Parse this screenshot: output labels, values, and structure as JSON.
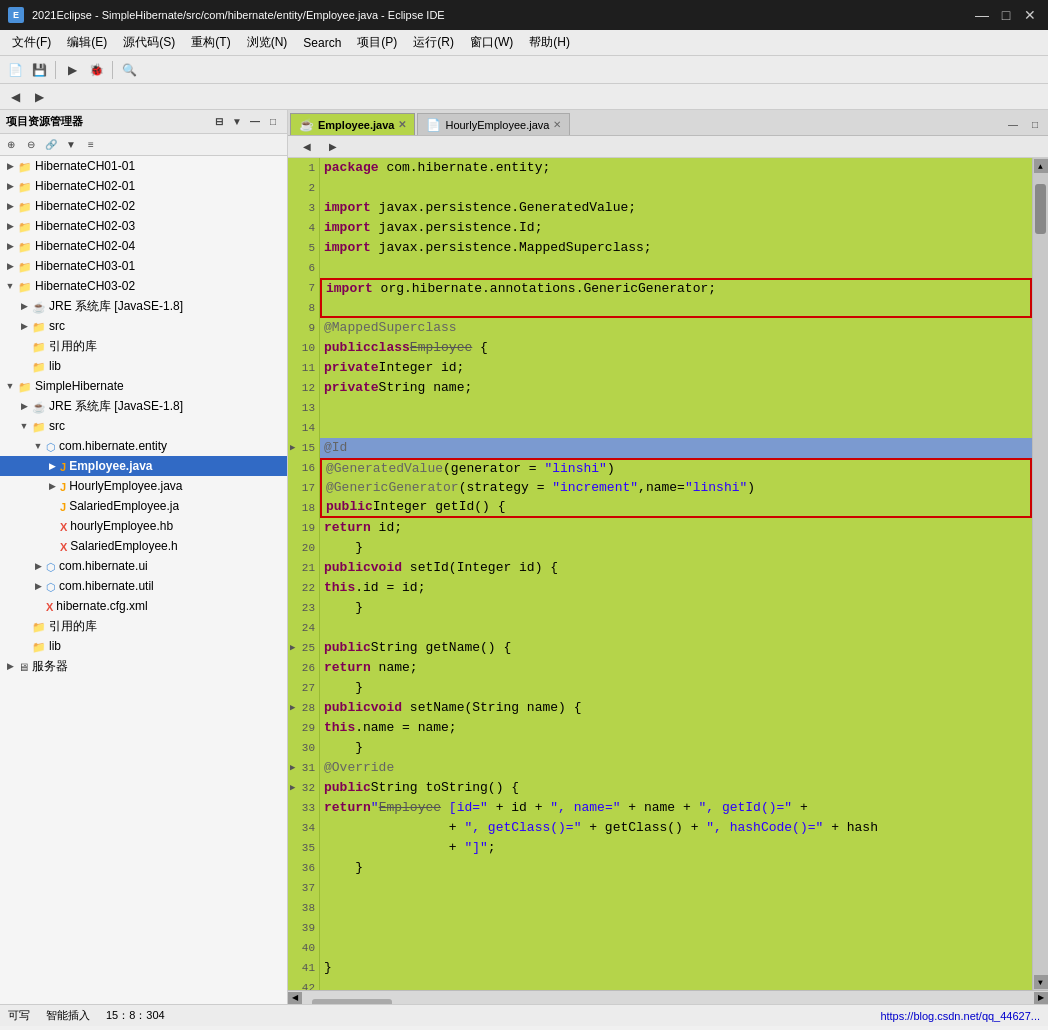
{
  "titlebar": {
    "title": "2021Eclipse - SimpleHibernate/src/com/hibernate/entity/Employee.java - Eclipse IDE",
    "icon": "E",
    "btn_min": "—",
    "btn_max": "□",
    "btn_close": "✕"
  },
  "menubar": {
    "items": [
      "文件(F)",
      "编辑(E)",
      "源代码(S)",
      "重构(T)",
      "浏览(N)",
      "Search",
      "项目(P)",
      "运行(R)",
      "窗口(W)",
      "帮助(H)"
    ]
  },
  "tabs": {
    "active": "Employee.java",
    "items": [
      "Employee.java",
      "HourlyEmployee.java"
    ]
  },
  "sidebar": {
    "title": "项目资源管理器",
    "tree": [
      {
        "indent": 0,
        "arrow": "▶",
        "icon": "📁",
        "label": "HibernateCH01-01",
        "type": "folder"
      },
      {
        "indent": 0,
        "arrow": "▶",
        "icon": "📁",
        "label": "HibernateCH02-01",
        "type": "folder"
      },
      {
        "indent": 0,
        "arrow": "▶",
        "icon": "📁",
        "label": "HibernateCH02-02",
        "type": "folder"
      },
      {
        "indent": 0,
        "arrow": "▶",
        "icon": "📁",
        "label": "HibernateCH02-03",
        "type": "folder"
      },
      {
        "indent": 0,
        "arrow": "▶",
        "icon": "📁",
        "label": "HibernateCH02-04",
        "type": "folder"
      },
      {
        "indent": 0,
        "arrow": "▶",
        "icon": "📁",
        "label": "HibernateCH03-01",
        "type": "folder"
      },
      {
        "indent": 0,
        "arrow": "▼",
        "icon": "📁",
        "label": "HibernateCH03-02",
        "type": "folder",
        "expanded": true
      },
      {
        "indent": 1,
        "arrow": "▶",
        "icon": "☕",
        "label": "JRE 系统库 [JavaSE-1.8]",
        "type": "lib"
      },
      {
        "indent": 1,
        "arrow": "▶",
        "icon": "📁",
        "label": "src",
        "type": "folder"
      },
      {
        "indent": 1,
        "arrow": " ",
        "icon": "📁",
        "label": "引用的库",
        "type": "folder"
      },
      {
        "indent": 1,
        "arrow": " ",
        "icon": "📁",
        "label": "lib",
        "type": "folder"
      },
      {
        "indent": 0,
        "arrow": "▼",
        "icon": "📁",
        "label": "SimpleHibernate",
        "type": "folder",
        "expanded": true
      },
      {
        "indent": 1,
        "arrow": "▶",
        "icon": "☕",
        "label": "JRE 系统库 [JavaSE-1.8]",
        "type": "lib"
      },
      {
        "indent": 1,
        "arrow": "▼",
        "icon": "📁",
        "label": "src",
        "type": "folder",
        "expanded": true
      },
      {
        "indent": 2,
        "arrow": "▼",
        "icon": "📦",
        "label": "com.hibernate.entity",
        "type": "package",
        "expanded": true
      },
      {
        "indent": 3,
        "arrow": "▶",
        "icon": "☕",
        "label": "Employee.java",
        "type": "java",
        "selected": true
      },
      {
        "indent": 3,
        "arrow": "▶",
        "icon": "☕",
        "label": "HourlyEmployee.java",
        "type": "java"
      },
      {
        "indent": 3,
        "arrow": " ",
        "icon": "📄",
        "label": "SalariedEmployee.ja",
        "type": "java"
      },
      {
        "indent": 3,
        "arrow": " ",
        "icon": "📄",
        "label": "hourlyEmployee.hb",
        "type": "xml"
      },
      {
        "indent": 3,
        "arrow": " ",
        "icon": "📄",
        "label": "SalariedEmployee.h",
        "type": "xml"
      },
      {
        "indent": 2,
        "arrow": "▶",
        "icon": "📦",
        "label": "com.hibernate.ui",
        "type": "package"
      },
      {
        "indent": 2,
        "arrow": "▶",
        "icon": "📦",
        "label": "com.hibernate.util",
        "type": "package"
      },
      {
        "indent": 2,
        "arrow": " ",
        "icon": "📄",
        "label": "hibernate.cfg.xml",
        "type": "xml"
      },
      {
        "indent": 1,
        "arrow": " ",
        "icon": "📁",
        "label": "引用的库",
        "type": "folder"
      },
      {
        "indent": 1,
        "arrow": " ",
        "icon": "📁",
        "label": "lib",
        "type": "folder"
      },
      {
        "indent": 0,
        "arrow": "▶",
        "icon": "🖥️",
        "label": "服务器",
        "type": "server"
      }
    ]
  },
  "code": {
    "lines": [
      {
        "num": 1,
        "content": "package com.hibernate.entity;",
        "style": "normal"
      },
      {
        "num": 2,
        "content": "",
        "style": "normal"
      },
      {
        "num": 3,
        "content": "import javax.persistence.GeneratedValue;",
        "style": "normal"
      },
      {
        "num": 4,
        "content": "import javax.persistence.Id;",
        "style": "normal"
      },
      {
        "num": 5,
        "content": "import javax.persistence.MappedSuperclass;",
        "style": "normal"
      },
      {
        "num": 6,
        "content": "",
        "style": "normal"
      },
      {
        "num": 7,
        "content": "import org.hibernate.annotations.GenericGenerator;",
        "style": "boxed-top"
      },
      {
        "num": 8,
        "content": "",
        "style": "boxed-bot"
      },
      {
        "num": 9,
        "content": "@MappedSuperclass",
        "style": "normal"
      },
      {
        "num": 10,
        "content": "public class Employee {",
        "style": "normal"
      },
      {
        "num": 11,
        "content": "    private Integer id;",
        "style": "normal"
      },
      {
        "num": 12,
        "content": "    private String name;",
        "style": "normal"
      },
      {
        "num": 13,
        "content": "",
        "style": "normal"
      },
      {
        "num": 14,
        "content": "",
        "style": "normal"
      },
      {
        "num": 15,
        "content": "    @Id",
        "style": "highlighted"
      },
      {
        "num": 16,
        "content": "    @GeneratedValue(generator = \"linshi\")",
        "style": "boxed2-top"
      },
      {
        "num": 17,
        "content": "    @GenericGenerator(strategy = \"increment\",name=\"linshi\")",
        "style": "boxed2-mid"
      },
      {
        "num": 18,
        "content": "    public Integer getId() {",
        "style": "boxed2-bot"
      },
      {
        "num": 19,
        "content": "        return id;",
        "style": "normal"
      },
      {
        "num": 20,
        "content": "    }",
        "style": "normal"
      },
      {
        "num": 21,
        "content": "    public void setId(Integer id) {",
        "style": "normal"
      },
      {
        "num": 22,
        "content": "        this.id = id;",
        "style": "normal"
      },
      {
        "num": 23,
        "content": "    }",
        "style": "normal"
      },
      {
        "num": 24,
        "content": "",
        "style": "normal"
      },
      {
        "num": 25,
        "content": "    public String getName() {",
        "style": "normal"
      },
      {
        "num": 26,
        "content": "        return name;",
        "style": "normal"
      },
      {
        "num": 27,
        "content": "    }",
        "style": "normal"
      },
      {
        "num": 28,
        "content": "    public void setName(String name) {",
        "style": "normal"
      },
      {
        "num": 29,
        "content": "        this.name = name;",
        "style": "normal"
      },
      {
        "num": 30,
        "content": "    }",
        "style": "normal"
      },
      {
        "num": 31,
        "content": "    @Override",
        "style": "normal"
      },
      {
        "num": 32,
        "content": "    public String toString() {",
        "style": "normal"
      },
      {
        "num": 33,
        "content": "        return \"Employee [id=\" + id + \", name=\" + name + \", getId()=\" +",
        "style": "normal"
      },
      {
        "num": 34,
        "content": "                + \", getClass()=\" + getClass() + \", hashCode()=\" + hash",
        "style": "normal"
      },
      {
        "num": 35,
        "content": "                + \"]\";",
        "style": "normal"
      },
      {
        "num": 36,
        "content": "    }",
        "style": "normal"
      },
      {
        "num": 37,
        "content": "",
        "style": "normal"
      },
      {
        "num": 38,
        "content": "",
        "style": "normal"
      },
      {
        "num": 39,
        "content": "",
        "style": "normal"
      },
      {
        "num": 40,
        "content": "",
        "style": "normal"
      },
      {
        "num": 41,
        "content": "}",
        "style": "normal"
      },
      {
        "num": 42,
        "content": "",
        "style": "normal"
      }
    ]
  },
  "statusbar": {
    "writable": "可写",
    "insert_mode": "智能插入",
    "position": "15：8：304",
    "url": "https://blog.csdn.net/qq_44627..."
  }
}
